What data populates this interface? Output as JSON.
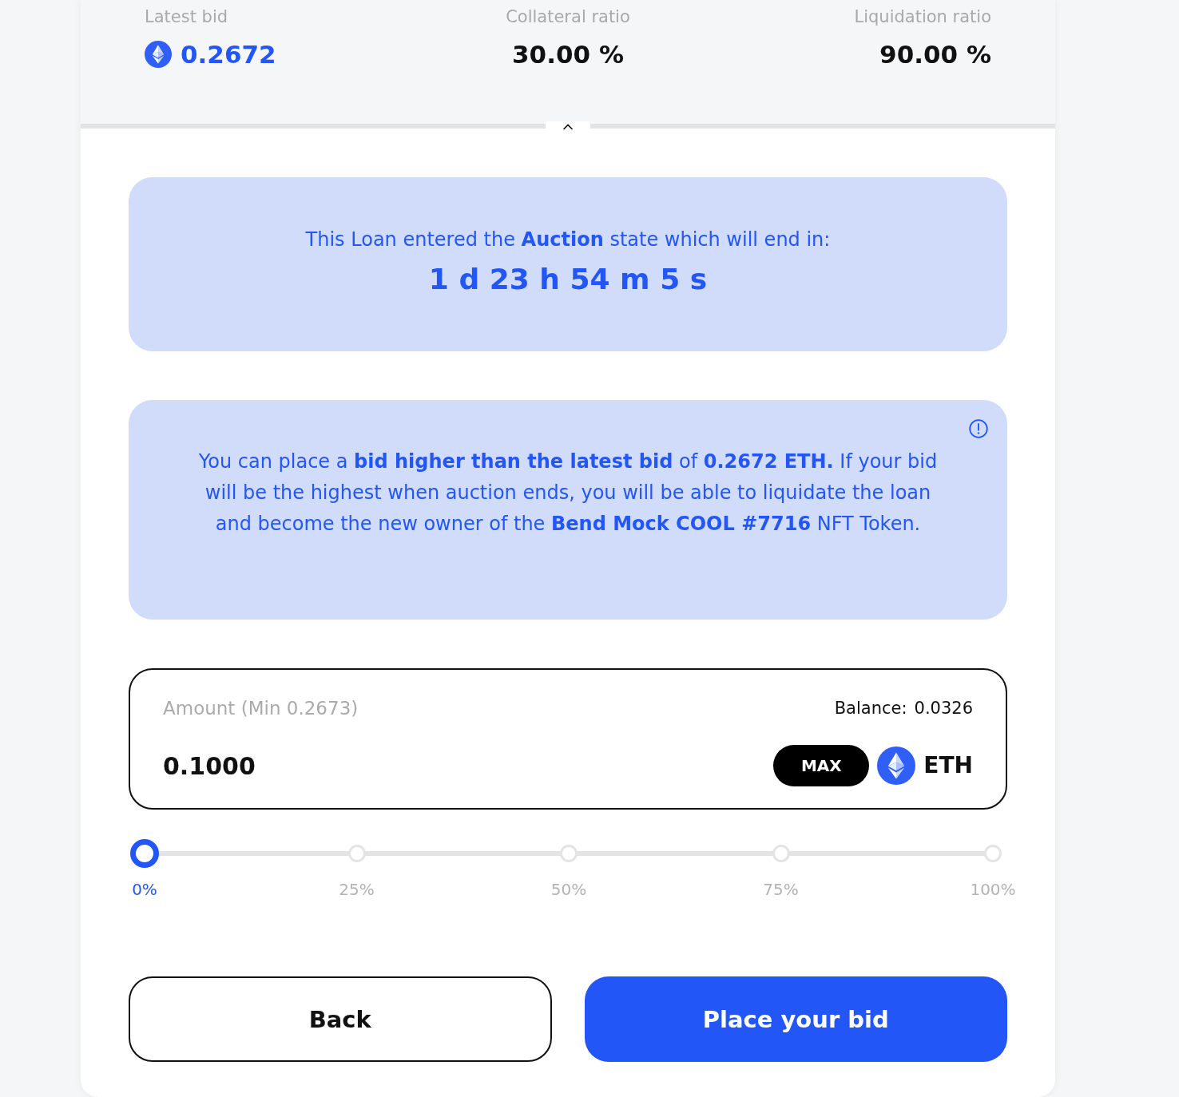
{
  "stats": [
    {
      "label": "Latest bid",
      "value": "0.2672",
      "kind": "eth"
    },
    {
      "label": "Collateral ratio",
      "value": "30.00 %",
      "kind": "plain"
    },
    {
      "label": "Liquidation ratio",
      "value": "90.00 %",
      "kind": "plain"
    }
  ],
  "auction_notice": {
    "text": "This Loan entered the **Auction** state which will end in:",
    "countdown": "1 d 23 h 54 m 5 s"
  },
  "bid_info": {
    "text": "You can place a **bid higher than the latest bid** of **0.2672 ETH.** If your bid will be the highest when auction ends, you will be able to liquidate the loan and become the new owner of the **Bend Mock COOL #7716** NFT Token."
  },
  "amount_field": {
    "label": "Amount (Min 0.2673)",
    "balance_label": "Balance:",
    "balance": "0.0326",
    "value": "0.1000",
    "max_button": "MAX",
    "currency": "ETH"
  },
  "slider": {
    "level": 0,
    "marks": [
      {
        "label": "0%",
        "selected": true
      },
      {
        "label": "25%",
        "selected": false
      },
      {
        "label": "50%",
        "selected": false
      },
      {
        "label": "75%",
        "selected": false
      },
      {
        "label": "100%",
        "selected": false
      }
    ]
  },
  "buttons": [
    {
      "label": "Back",
      "kind": "secondary"
    },
    {
      "label": "Place your bid",
      "kind": "primary"
    }
  ]
}
